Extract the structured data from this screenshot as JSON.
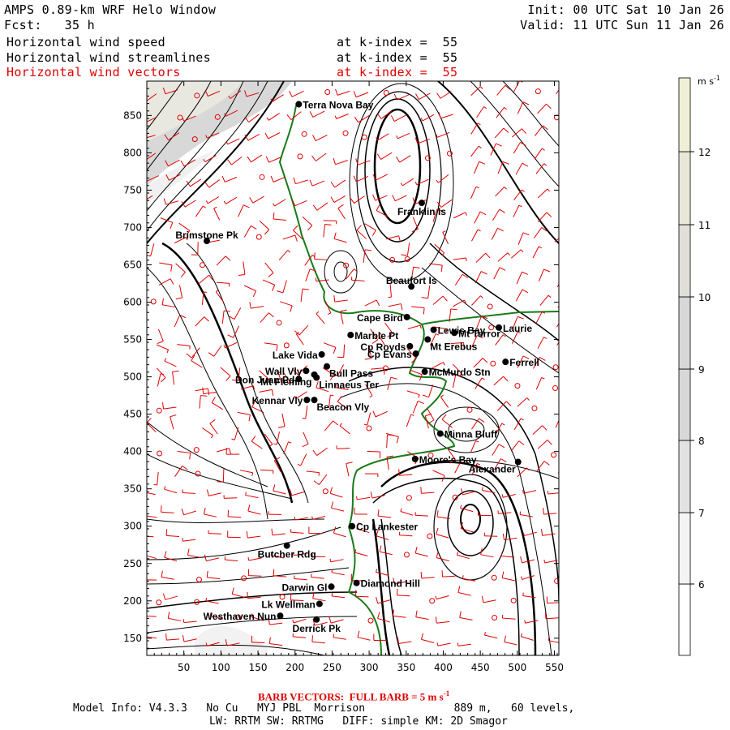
{
  "header": {
    "title": "AMPS 0.89-km WRF Helo Window",
    "forecast": "Fcst:   35 h",
    "init": "Init: 00 UTC Sat 10 Jan 26",
    "valid": "Valid: 11 UTC Sun 11 Jan 26",
    "fields": [
      {
        "name": "Horizontal wind speed",
        "level": "at k-index =  55",
        "color": "#000000"
      },
      {
        "name": "Horizontal wind streamlines",
        "level": "at k-index =  55",
        "color": "#000000"
      },
      {
        "name": "Horizontal wind vectors",
        "level": "at k-index =  55",
        "color": "#e00000"
      }
    ]
  },
  "map": {
    "x_ticks": [
      "50",
      "100",
      "150",
      "200",
      "250",
      "300",
      "350",
      "400",
      "450",
      "500",
      "550"
    ],
    "y_ticks": [
      "850",
      "800",
      "750",
      "700",
      "650",
      "600",
      "550",
      "500",
      "450",
      "400",
      "350",
      "300",
      "250",
      "200",
      "150"
    ],
    "x_range": [
      0,
      556
    ],
    "y_range": [
      127,
      896
    ],
    "coastline_color": "#1a7a1a",
    "streamline_color": "#000000",
    "vector_color": "#e00000",
    "stations": [
      {
        "name": "Terra Nova Bay",
        "x": 205,
        "y": 865,
        "label_side": "right"
      },
      {
        "name": "Franklin Is",
        "x": 371,
        "y": 733,
        "label_side": "below"
      },
      {
        "name": "Brimstone Pk",
        "x": 81,
        "y": 682,
        "label_side": "above"
      },
      {
        "name": "Beaufort Is",
        "x": 357,
        "y": 621,
        "label_side": "above"
      },
      {
        "name": "Cape Bird",
        "x": 351,
        "y": 580,
        "label_side": "left"
      },
      {
        "name": "Lewis Bay",
        "x": 387,
        "y": 563,
        "label_side": "right"
      },
      {
        "name": "Mt Terror",
        "x": 415,
        "y": 559,
        "label_side": "right"
      },
      {
        "name": "Laurie",
        "x": 475,
        "y": 566,
        "label_side": "right"
      },
      {
        "name": "Marble Pt",
        "x": 275,
        "y": 556,
        "label_side": "right"
      },
      {
        "name": "Mt Erebus",
        "x": 379,
        "y": 550,
        "label_side": "right-low"
      },
      {
        "name": "Cp Royds",
        "x": 355,
        "y": 541,
        "label_side": "left"
      },
      {
        "name": "Cp Evans",
        "x": 363,
        "y": 531,
        "label_side": "left"
      },
      {
        "name": "Ferrell",
        "x": 484,
        "y": 520,
        "label_side": "right"
      },
      {
        "name": "Lake Vida",
        "x": 236,
        "y": 530,
        "label_side": "left"
      },
      {
        "name": "McMurdo Stn",
        "x": 375,
        "y": 507,
        "label_side": "right"
      },
      {
        "name": "Bull Pass",
        "x": 243,
        "y": 514,
        "label_side": "right-low"
      },
      {
        "name": "Wall Vly",
        "x": 215,
        "y": 508,
        "label_side": "left"
      },
      {
        "name": "Don Juan Pd",
        "x": 205,
        "y": 497,
        "label_side": "left"
      },
      {
        "name": "Mt Fleming",
        "x": 226,
        "y": 503,
        "label_side": "left-low"
      },
      {
        "name": "Linnaeus Ter",
        "x": 229,
        "y": 499,
        "label_side": "right-low"
      },
      {
        "name": "Kennar Vly",
        "x": 216,
        "y": 469,
        "label_side": "left"
      },
      {
        "name": "Beacon Vly",
        "x": 226,
        "y": 469,
        "label_side": "right-low"
      },
      {
        "name": "Minna Bluff",
        "x": 396,
        "y": 424,
        "label_side": "right"
      },
      {
        "name": "Moore's Bay",
        "x": 362,
        "y": 390,
        "label_side": "right"
      },
      {
        "name": "Alexander",
        "x": 501,
        "y": 386,
        "label_side": "left-low"
      },
      {
        "name": "Cp Lankester",
        "x": 277,
        "y": 300,
        "label_side": "right"
      },
      {
        "name": "Butcher Rdg",
        "x": 189,
        "y": 274,
        "label_side": "below"
      },
      {
        "name": "Diamond Hill",
        "x": 283,
        "y": 224,
        "label_side": "right"
      },
      {
        "name": "Darwin Gl",
        "x": 249,
        "y": 219,
        "label_side": "left"
      },
      {
        "name": "Lk Wellman",
        "x": 233,
        "y": 196,
        "label_side": "left"
      },
      {
        "name": "Westhaven Nun",
        "x": 180,
        "y": 180,
        "label_side": "left"
      },
      {
        "name": "Derrick Pk",
        "x": 229,
        "y": 175,
        "label_side": "below"
      }
    ]
  },
  "colorbar": {
    "units": "m s",
    "units_exp": "-1",
    "labels": [
      "12",
      "11",
      "10",
      "9",
      "8",
      "7",
      "6"
    ],
    "bins": [
      {
        "range": "<6",
        "color": "#ffffff"
      },
      {
        "range": "6-7",
        "color": "#f4f4f4"
      },
      {
        "range": "7-8",
        "color": "#e2e2e2"
      },
      {
        "range": "8-9",
        "color": "#d8d8d8"
      },
      {
        "range": "9-10",
        "color": "#d8d8d8"
      },
      {
        "range": "10-11",
        "color": "#e0e0d8"
      },
      {
        "range": "11-12",
        "color": "#e8e8d8"
      },
      {
        "range": ">12",
        "color": "#f0f0d8"
      }
    ]
  },
  "footer": {
    "barb_note": "BARB VECTORS:  FULL BARB = 5 m s",
    "barb_note_exp": "-1",
    "model_info": "Model Info: V4.3.3   No Cu   MYJ PBL  Morrison              889 m,   60 levels,",
    "physics": "LW: RRTM SW: RRTMG   DIFF: simple KM: 2D Smagor"
  }
}
